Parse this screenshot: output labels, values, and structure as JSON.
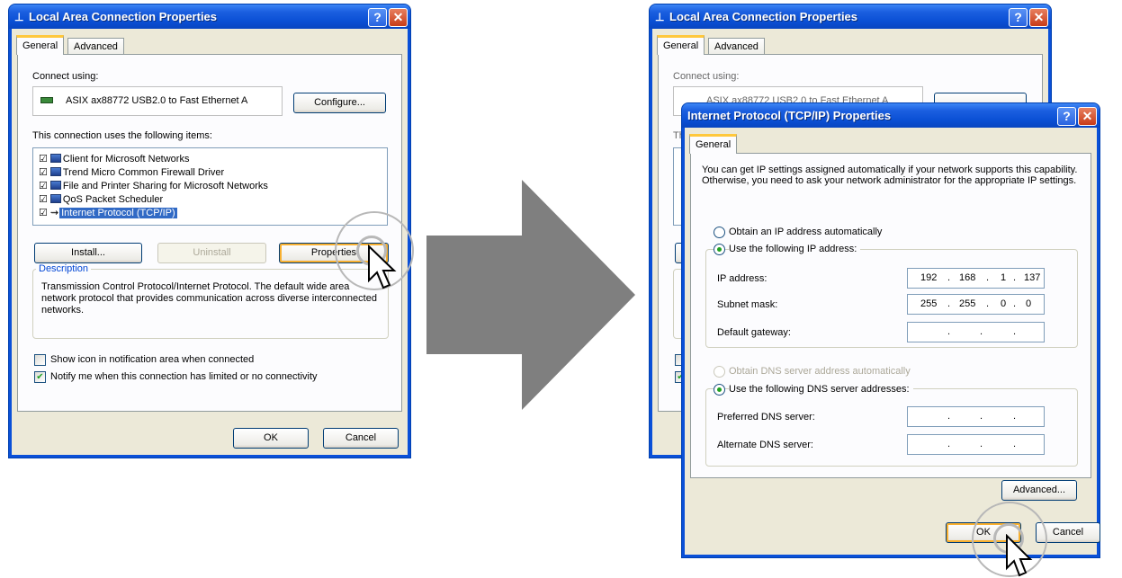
{
  "left_dialog": {
    "title": "Local Area Connection Properties",
    "tabs": [
      "General",
      "Advanced"
    ],
    "connect_using_label": "Connect using:",
    "adapter_name": "ASIX ax88772 USB2.0 to Fast Ethernet A",
    "configure_button": "Configure...",
    "items_label": "This connection uses the following items:",
    "items": [
      {
        "label": "Client for Microsoft Networks",
        "checked": true
      },
      {
        "label": "Trend Micro Common Firewall Driver",
        "checked": true
      },
      {
        "label": "File and Printer Sharing for Microsoft Networks",
        "checked": true
      },
      {
        "label": "QoS Packet Scheduler",
        "checked": true
      },
      {
        "label": "Internet Protocol (TCP/IP)",
        "checked": true,
        "selected": true
      }
    ],
    "install_button": "Install...",
    "uninstall_button": "Uninstall",
    "properties_button": "Properties",
    "description_title": "Description",
    "description_text": "Transmission Control Protocol/Internet Protocol. The default wide area network protocol that provides communication across diverse interconnected networks.",
    "show_icon_label": "Show icon in notification area when connected",
    "notify_label": "Notify me when this connection has limited or no connectivity",
    "ok_button": "OK",
    "cancel_button": "Cancel"
  },
  "right_back_dialog": {
    "title": "Local Area Connection Properties",
    "tabs": [
      "General",
      "Advanced"
    ],
    "connect_using_label": "Connect using:",
    "adapter_name": "ASIX ax88772 USB2.0 to Fast Ethernet A",
    "partial_label": "Th"
  },
  "tcpip_dialog": {
    "title": "Internet Protocol (TCP/IP) Properties",
    "tab": "General",
    "intro_text": "You can get IP settings assigned automatically if your network supports this capability. Otherwise, you need to ask your network administrator for the appropriate IP settings.",
    "obtain_ip_auto": "Obtain an IP address automatically",
    "use_following_ip": "Use the following IP address:",
    "ip_address_label": "IP address:",
    "ip_address_value": [
      "192",
      "168",
      "1",
      "137"
    ],
    "subnet_mask_label": "Subnet mask:",
    "subnet_mask_value": [
      "255",
      "255",
      "0",
      "0"
    ],
    "default_gateway_label": "Default gateway:",
    "obtain_dns_auto": "Obtain DNS server address automatically",
    "use_following_dns": "Use the following DNS server addresses:",
    "preferred_dns_label": "Preferred DNS server:",
    "alternate_dns_label": "Alternate DNS server:",
    "advanced_button": "Advanced...",
    "ok_button": "OK",
    "cancel_button": "Cancel"
  },
  "colors": {
    "titlebar": "#0a4fd4",
    "dialog_bg": "#ece9d8",
    "arrow": "#7f7f7f",
    "selection": "#316ac5"
  }
}
